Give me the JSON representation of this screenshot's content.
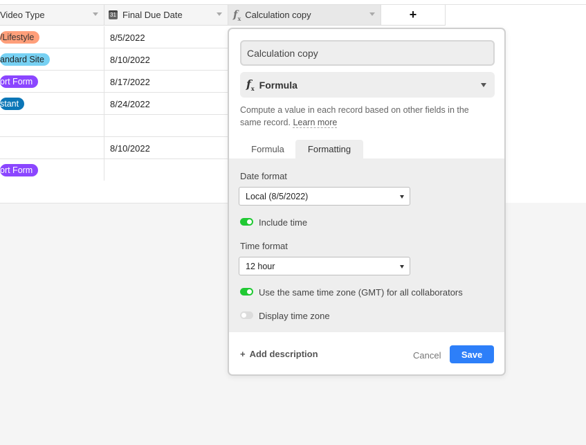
{
  "grid": {
    "columns": {
      "video_type": "Video Type",
      "final_due_date": "Final Due Date",
      "calculation_copy": "Calculation copy",
      "add_field": "+"
    },
    "date_icon_label": "31",
    "rows": [
      {
        "video_type": "/Lifestyle",
        "video_type_color": "#ff9f7a",
        "video_type_text_color": "#333333",
        "due": "8/5/2022"
      },
      {
        "video_type": "andard Site",
        "video_type_color": "#77d1f3",
        "video_type_text_color": "#222222",
        "due": "8/10/2022"
      },
      {
        "video_type": "ort Form",
        "video_type_color": "#8b46ff",
        "video_type_text_color": "#ffffff",
        "due": "8/17/2022"
      },
      {
        "video_type": "stant",
        "video_type_color": "#0b76b7",
        "video_type_text_color": "#ffffff",
        "due": "8/24/2022"
      },
      {
        "video_type": "",
        "video_type_color": "",
        "video_type_text_color": "",
        "due": ""
      },
      {
        "video_type": "",
        "video_type_color": "",
        "video_type_text_color": "",
        "due": "8/10/2022"
      },
      {
        "video_type": "ort Form",
        "video_type_color": "#8b46ff",
        "video_type_text_color": "#ffffff",
        "due": ""
      }
    ]
  },
  "dialog": {
    "field_name": "Calculation copy",
    "field_type": "Formula",
    "description": "Compute a value in each record based on other fields in the same record.",
    "learn_more": "Learn more",
    "tabs": {
      "formula": "Formula",
      "formatting": "Formatting"
    },
    "date_format_label": "Date format",
    "date_format_value": "Local (8/5/2022)",
    "include_time_label": "Include time",
    "include_time_on": true,
    "time_format_label": "Time format",
    "time_format_value": "12 hour",
    "same_tz_label": "Use the same time zone (GMT) for all collaborators",
    "same_tz_on": true,
    "display_tz_label": "Display time zone",
    "display_tz_on": false,
    "add_description": "Add description",
    "add_description_icon": "+",
    "cancel": "Cancel",
    "save": "Save"
  },
  "colors": {
    "accent": "#2d7ff9",
    "toggle_on": "#20c933"
  }
}
